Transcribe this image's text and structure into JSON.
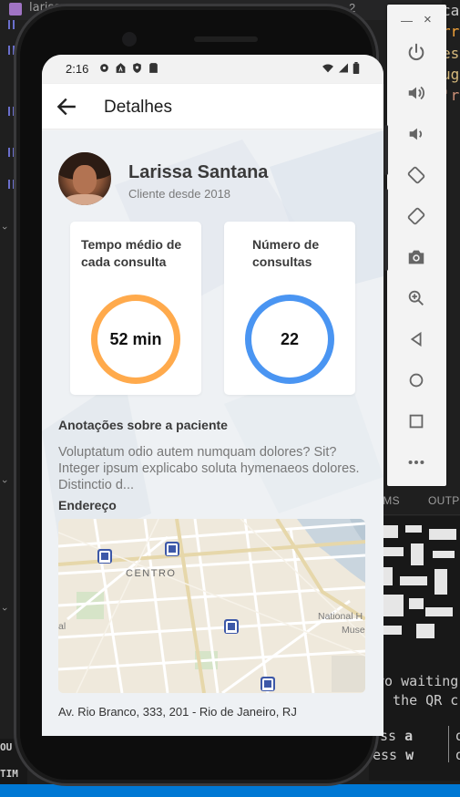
{
  "editor": {
    "tab_title": "larissa.png",
    "tab_number": "2",
    "code_lines": [
      {
        "text": "ca",
        "color": "#cccccc"
      },
      {
        "text": "rr",
        "color": "#f5a43a"
      },
      {
        "text": "es",
        "color": "#d7ba7d"
      },
      {
        "text": "ug",
        "color": "#d7ba7d"
      },
      {
        "text": "'r",
        "color": "#ce9178"
      }
    ],
    "panel_tabs": [
      "EMS",
      "OUTP"
    ],
    "terminal_lines": [
      "ro waiting",
      "n the QR c"
    ],
    "key_lines": [
      {
        "key": "ss",
        "letter": "a",
        "after": "ope"
      },
      {
        "key": "ess",
        "letter": "w",
        "after": "ope"
      }
    ],
    "bottom_left": [
      "OU",
      "TIM"
    ]
  },
  "emulator": {
    "minimize_label": "—",
    "close_label": "×",
    "buttons": [
      "power-icon",
      "volume-up-icon",
      "volume-down-icon",
      "rotate-left-icon",
      "rotate-right-icon",
      "camera-icon",
      "zoom-icon",
      "back-icon",
      "home-icon",
      "overview-icon",
      "more-icon"
    ]
  },
  "status_bar": {
    "time": "2:16"
  },
  "header": {
    "title": "Detalhes"
  },
  "patient": {
    "name": "Larissa Santana",
    "since": "Cliente desde 2018"
  },
  "stats": [
    {
      "title": "Tempo médio de cada consulta",
      "value": "52 min",
      "color": "#ffaa4c"
    },
    {
      "title": "Número de consultas",
      "value": "22",
      "color": "#4a95f2"
    }
  ],
  "notes": {
    "title": "Anotações sobre a paciente",
    "text": "Voluptatum odio autem numquam dolores? Sit? Integer ipsum explicabo soluta hymenaeos dolores. Distinctio d..."
  },
  "address": {
    "title": "Endereço",
    "map_label": "CENTRO",
    "map_label_2": "National H",
    "map_label_3": "Muse",
    "map_label_4": "al",
    "text": "Av. Rio Branco, 333, 201 - Rio de Janeiro, RJ"
  }
}
